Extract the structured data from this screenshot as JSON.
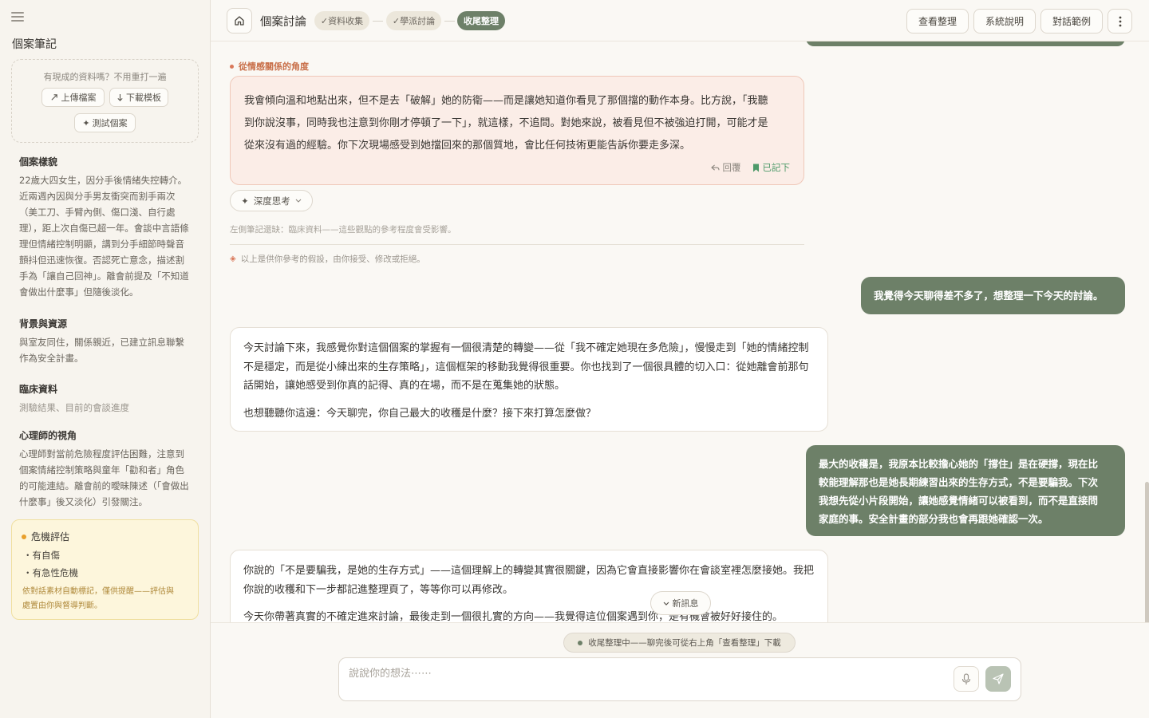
{
  "sidebar": {
    "menu_icon": "hamburger-icon",
    "title": "個案筆記",
    "upload_hint": "有現成的資料嗎？不用重打一遍",
    "upload_label": "上傳檔案",
    "download_label": "下載模板",
    "test_case_label": "測試個案",
    "sections": [
      {
        "heading": "個案樣貌",
        "lines": [
          "22歲大四女生，因分手後情緒失控轉介。",
          "近兩週內因與分手男友衝突而割手兩次",
          "（美工刀、手臂內側、傷口淺、自行處",
          "理），距上次自傷已超一年。會談中言語條",
          "理但情緒控制明顯，講到分手細節時聲音",
          "顫抖但迅速恢復。否認死亡意念，描述割",
          "手為「讓自己回神」。離會前提及「不知道",
          "會做出什麼事」但隨後淡化。"
        ]
      },
      {
        "heading": "背景與資源",
        "lines": [
          "與室友同住，關係親近，已建立訊息聯繫",
          "作為安全計畫。"
        ]
      },
      {
        "heading": "臨床資料",
        "lines": [
          "測驗結果、目前的會談進度"
        ]
      },
      {
        "heading": "心理師的視角",
        "lines": [
          "心理師對當前危險程度評估困難，注意到",
          "個案情緒控制策略與童年「勸和者」角色",
          "的可能連結。離會前的曖昧陳述（「會做出",
          "什麼事」後又淡化）引發關注。"
        ]
      }
    ],
    "crisis": {
      "title": "危機評估",
      "items": [
        "有自傷",
        "有急性危機"
      ],
      "note_lines": [
        "依對話素材自動標記，僅供提醒——評估與",
        "處置由你與督導判斷。"
      ]
    }
  },
  "topbar": {
    "home_icon": "home-icon",
    "title": "個案討論",
    "steps": [
      {
        "label": "資料收集",
        "done": true
      },
      {
        "label": "學派討論",
        "done": true
      },
      {
        "label": "收尾整理",
        "done": false
      }
    ],
    "buttons": [
      "查看整理",
      "系統說明",
      "對話範例"
    ],
    "more_icon": "more-vertical-icon"
  },
  "chat": {
    "emotion_tag": "從情感關係的角度",
    "emotion_lines": [
      "我會傾向溫和地點出來，但不是去「破解」她的防衛——而是讓她知道你看見了那個擋的動作本身。比方說，「我聽",
      "到你說沒事，同時我也注意到你剛才停頓了一下」，就這樣，不追問。對她來說，被看見但不被強迫打開，可能才是",
      "從來沒有過的經驗。你下次現場感受到她擋回來的那個質地，會比任何技術更能告訴你要走多深。"
    ],
    "reply_label": "回覆",
    "saved_label": "已記下",
    "deep_think_label": "深度思考",
    "missing_note": "左側筆記還缺：臨床資料——這些觀點的參考程度會受影響。",
    "disclaimer": "以上是供你參考的假設，由你接受、修改或拒絕。",
    "user_msg_1": "我覺得今天聊得差不多了，想整理一下今天的討論。",
    "ai_msg_1": {
      "p1_lines": [
        "今天討論下來，我感覺你對這個個案的掌握有一個很清楚的轉變——從「我不確定她現在多危險」，慢慢走到「她的情緒控制",
        "不是穩定，而是從小練出來的生存策略」，這個框架的移動我覺得很重要。你也找到了一個很具體的切入口：從她離會前那句",
        "話開始，讓她感受到你真的記得、真的在場，而不是在蒐集她的狀態。"
      ],
      "p2": "也想聽聽你這邊：今天聊完，你自己最大的收穫是什麼？接下來打算怎麼做？"
    },
    "user_msg_2_lines": [
      "最大的收穫是，我原本比較擔心她的「撐住」是在硬撐，現在比",
      "較能理解那也是她長期練習出來的生存方式，不是要騙我。下次",
      "我想先從小片段開始，讓她感覺情緒可以被看到，而不是直接問",
      "家庭的事。安全計畫的部分我也會再跟她確認一次。"
    ],
    "ai_msg_2": {
      "p1_lines": [
        "你說的「不是要騙我，是她的生存方式」——這個理解上的轉變其實很關鍵，因為它會直接影響你在會談室裡怎麼接她。我把",
        "你說的收穫和下一步都記進整理頁了，等等你可以再修改。"
      ],
      "p2": "今天你帶著真實的不確定進來討論，最後走到一個很扎實的方向——我覺得這位個案遇到你，是有機會被好好接住的。"
    },
    "new_msg_label": "新訊息"
  },
  "composer": {
    "status": "收尾整理中——聊完後可從右上角「查看整理」下載",
    "placeholder": "說說你的想法⋯⋯",
    "mic_icon": "microphone-icon",
    "send_icon": "send-icon"
  },
  "colors": {
    "accent_green": "#6d8068",
    "tag_orange": "#c9704a",
    "saved_green": "#4e9a6a",
    "crisis_bg": "#fdf6dc",
    "emotion_card_bg": "#fbede7"
  }
}
